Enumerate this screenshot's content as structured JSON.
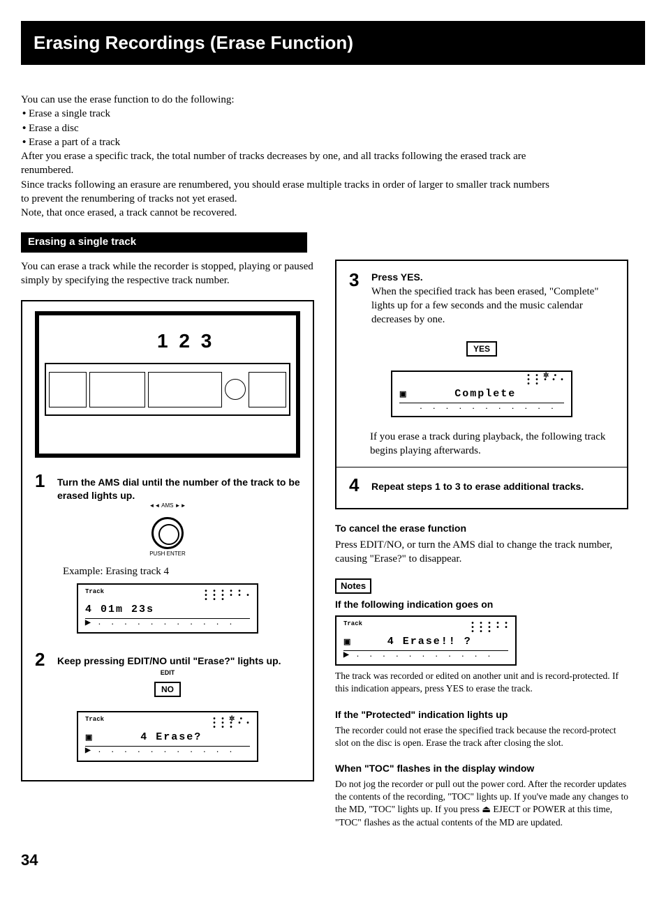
{
  "title": "Erasing Recordings (Erase Function)",
  "intro": {
    "lead": "You can use the erase function to do the following:",
    "bullets": [
      "Erase a single track",
      "Erase a disc",
      "Erase a part of a track"
    ],
    "para1": "After you erase a specific track, the total number of tracks decreases by one, and all tracks following the erased track are renumbered.",
    "para2": "Since tracks following an erasure are renumbered, you should erase multiple tracks in order of larger to smaller track numbers to prevent the renumbering of tracks not yet erased.",
    "para3": "Note, that once erased, a track cannot be recovered."
  },
  "subhead": "Erasing a single track",
  "erase_note": "You can erase a track while the recorder is stopped, playing or paused simply by specifying the respective track number.",
  "device_labels": "1 2 3",
  "steps": {
    "s1": {
      "num": "1",
      "text": "Turn the AMS dial until the number of the track to be erased lights up.",
      "dial_top": "◄◄ AMS ►►",
      "dial_bottom": "PUSH ENTER",
      "example": "Example: Erasing track 4",
      "lcd_main": "4   01m 23s",
      "lcd_dots": "• • • • •\n• • • • • •\n• • •"
    },
    "s2": {
      "num": "2",
      "text": "Keep pressing EDIT/NO until \"Erase?\" lights up.",
      "btn_label": "EDIT",
      "btn": "NO",
      "lcd_main": "4  Erase?",
      "lcd_dots": "• • ✲ •\n• • • • •\n• • •"
    },
    "s3": {
      "num": "3",
      "head": "Press YES.",
      "text": "When the specified track has been erased, \"Complete\" lights up for a few seconds and the music calendar decreases by one.",
      "btn": "YES",
      "lcd_main": "Complete",
      "lcd_dots": "• • ✲ •\n• • • • •\n• •",
      "after": "If you erase a track during playback, the following track begins playing afterwards."
    },
    "s4": {
      "num": "4",
      "text": "Repeat steps 1 to 3 to erase additional tracks."
    }
  },
  "cancel": {
    "head": "To cancel the erase function",
    "text": "Press EDIT/NO, or turn the AMS dial to change the track number, causing \"Erase?\" to disappear."
  },
  "notes": {
    "label": "Notes",
    "n1_head": "If the following indication goes on",
    "n1_lcd": "4  Erase!! ?",
    "n1_text": "The track was recorded or edited on another unit and is record-protected. If this indication appears, press YES to erase the track.",
    "n2_head": "If the \"Protected\" indication lights up",
    "n2_text": "The recorder could not erase the specified track because the record-protect slot on the disc is open. Erase the track after closing the slot.",
    "n3_head": "When \"TOC\" flashes in the display window",
    "n3_text": "Do not jog the recorder or pull out the power cord. After the recorder updates the contents of the recording, \"TOC\" lights up. If you've made any changes to the MD, \"TOC\" lights up. If you press ⏏ EJECT or POWER at this time, \"TOC\" flashes as the actual contents of the MD are updated."
  },
  "page": "34"
}
